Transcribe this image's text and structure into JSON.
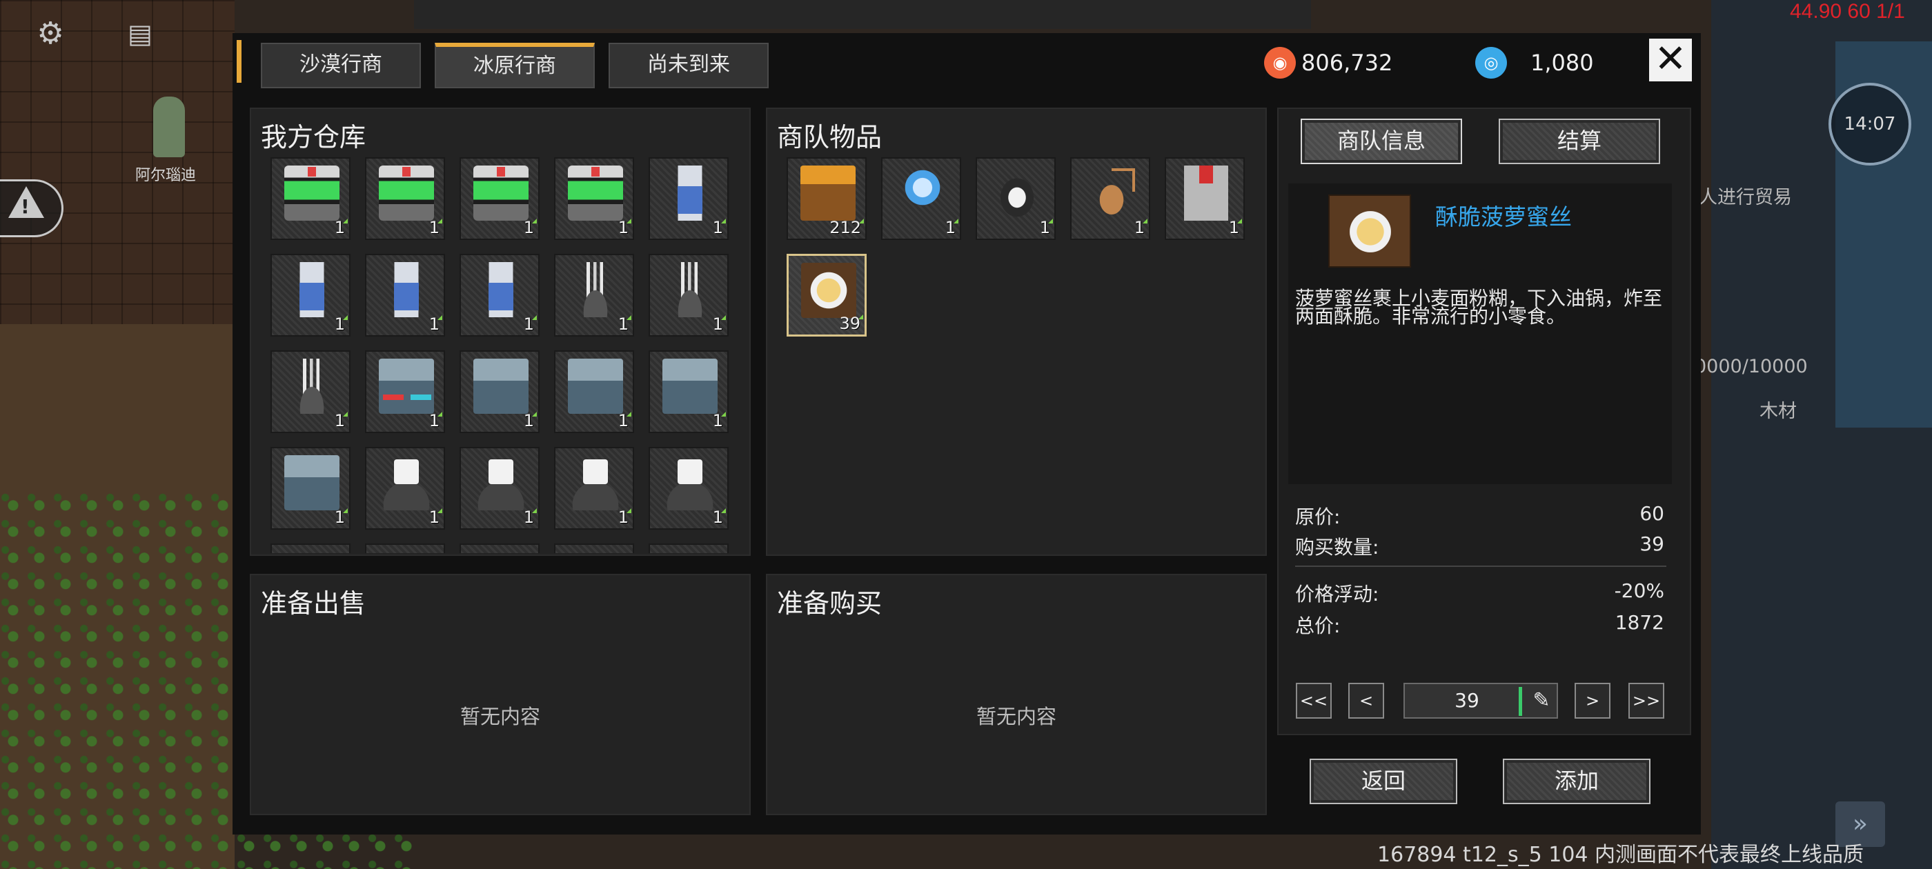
{
  "hud": {
    "fps": "44.90 60 1/1",
    "character_name": "阿尔瑙迪",
    "clock_time": "14:07",
    "version_text": "167894 t12_s_5 104 内测画面不代表最终上线品质",
    "bg_trade_hint": "人进行贸易",
    "bg_storage": "0000/10000",
    "bg_wood": "木材"
  },
  "tabs": [
    {
      "label": "沙漠行商",
      "active": false
    },
    {
      "label": "冰原行商",
      "active": true
    },
    {
      "label": "尚未到来",
      "active": false
    }
  ],
  "currency": {
    "gold": "806,732",
    "gems": "1,080",
    "gold_color": "#f0633a",
    "gem_color": "#3aa9e8"
  },
  "warehouse": {
    "title": "我方仓库",
    "items": [
      {
        "icon": "med-station",
        "qty": "1"
      },
      {
        "icon": "med-station",
        "qty": "1"
      },
      {
        "icon": "med-station",
        "qty": "1"
      },
      {
        "icon": "med-station",
        "qty": "1"
      },
      {
        "icon": "oxygen-tank",
        "qty": "1"
      },
      {
        "icon": "oxygen-tank",
        "qty": "1"
      },
      {
        "icon": "oxygen-tank",
        "qty": "1"
      },
      {
        "icon": "oxygen-tank",
        "qty": "1"
      },
      {
        "icon": "crystal-device",
        "qty": "1"
      },
      {
        "icon": "crystal-device",
        "qty": "1"
      },
      {
        "icon": "crystal-device",
        "qty": "1"
      },
      {
        "icon": "machine-console",
        "qty": "1"
      },
      {
        "icon": "storage-box",
        "qty": "1"
      },
      {
        "icon": "storage-box",
        "qty": "1"
      },
      {
        "icon": "storage-box",
        "qty": "1"
      },
      {
        "icon": "storage-box",
        "qty": "1"
      },
      {
        "icon": "white-cube-device",
        "qty": "1"
      },
      {
        "icon": "white-cube-device",
        "qty": "1"
      },
      {
        "icon": "white-cube-device",
        "qty": "1"
      },
      {
        "icon": "white-cube-device",
        "qty": "1"
      }
    ]
  },
  "caravan": {
    "title": "商队物品",
    "items": [
      {
        "icon": "fruit-crate",
        "qty": "212"
      },
      {
        "icon": "ice-spirit",
        "qty": "1"
      },
      {
        "icon": "penguin",
        "qty": "1"
      },
      {
        "icon": "deer",
        "qty": "1"
      },
      {
        "icon": "turret",
        "qty": "1"
      },
      {
        "icon": "pineapple-snack",
        "qty": "39",
        "selected": true
      }
    ]
  },
  "sell": {
    "title": "准备出售",
    "empty": "暂无内容"
  },
  "buy": {
    "title": "准备购买",
    "empty": "暂无内容"
  },
  "info": {
    "tab_info": "商队信息",
    "tab_checkout": "结算",
    "item_name": "酥脆菠萝蜜丝",
    "item_desc": "菠萝蜜丝裹上小麦面粉糊，下入油锅，炸至两面酥脆。非常流行的小零食。",
    "item_name_color": "#37a7ec",
    "base_price_label": "原价:",
    "base_price": "60",
    "quantity_label": "购买数量:",
    "quantity": "39",
    "fluctuation_label": "价格浮动:",
    "fluctuation": "-20%",
    "total_label": "总价:",
    "total": "1872",
    "stepper": {
      "first": "<<",
      "prev": "<",
      "value": "39",
      "next": ">",
      "last": ">>"
    },
    "back_label": "返回",
    "add_label": "添加"
  }
}
